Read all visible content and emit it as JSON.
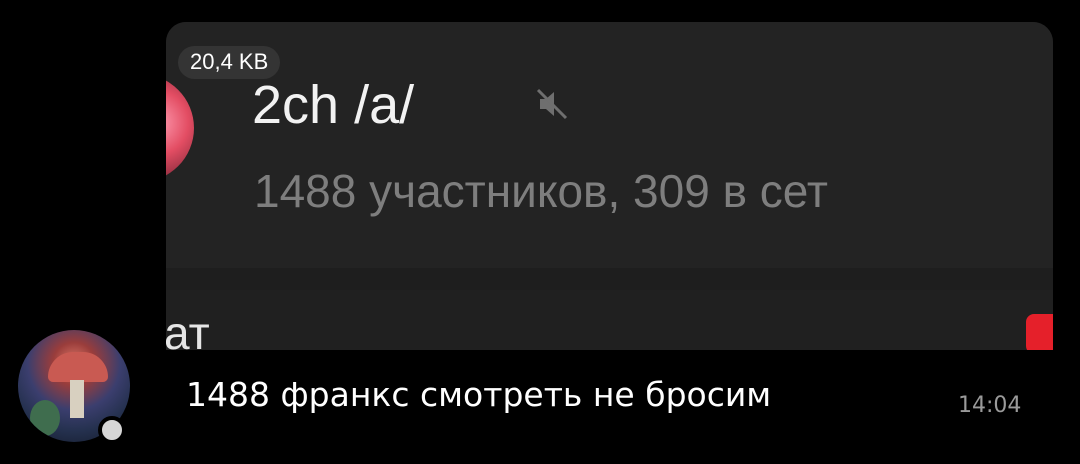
{
  "attachment": {
    "file_size": "20,4 KB",
    "screenshot_title": "2ch /a/",
    "screenshot_subtitle": "1488 участников, 309 в сет",
    "screenshot_lower_text": "ат",
    "mute_icon": "muted-speaker-icon",
    "colors": {
      "badge_red": "#e5202a",
      "title": "#f2f2f2",
      "subtitle": "#7e7e7e"
    }
  },
  "message": {
    "text": "1488 франкс смотреть не бросим",
    "time": "14:04"
  },
  "sender": {
    "avatar_icon": "avatar-mushroom-art",
    "online_indicator": "online-dot"
  }
}
